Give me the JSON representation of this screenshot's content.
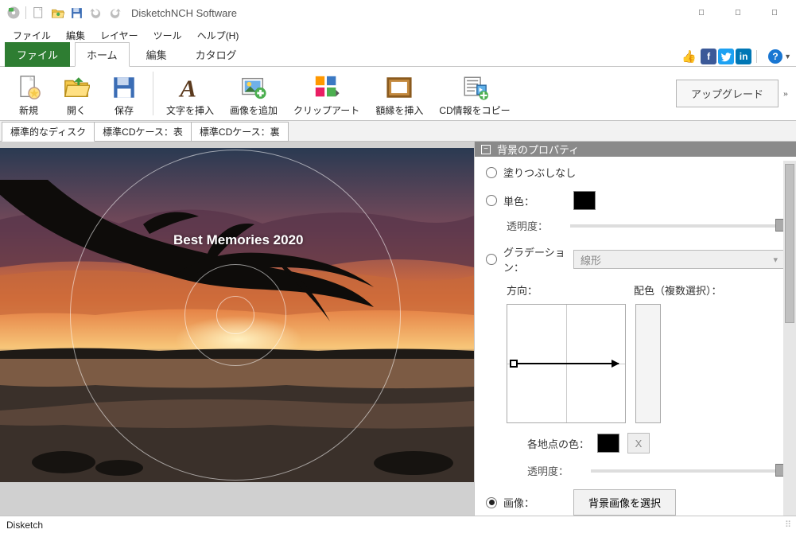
{
  "window": {
    "title": "DisketchNCH Software"
  },
  "menubar": {
    "file": "ファイル",
    "edit": "編集",
    "layer": "レイヤー",
    "tool": "ツール",
    "help": "ヘルプ(H)"
  },
  "ribbon_tabs": {
    "file": "ファイル",
    "home": "ホーム",
    "edit": "編集",
    "catalog": "カタログ"
  },
  "ribbon_buttons": {
    "new": "新規",
    "open": "開く",
    "save": "保存",
    "insert_text": "文字を挿入",
    "add_image": "画像を追加",
    "clipart": "クリップアート",
    "insert_frame": "額縁を挿入",
    "copy_cdinfo": "CD情報をコピー"
  },
  "upgrade": {
    "label": "アップグレード"
  },
  "doc_tabs": {
    "standard_disc": "標準的なディスク",
    "cd_case_front": "標準CDケース：表",
    "cd_case_back": "標準CDケース：裏"
  },
  "canvas": {
    "disc_title": "Best Memories 2020"
  },
  "prop": {
    "header": "背景のプロパティ",
    "fill_none": "塗りつぶしなし",
    "fill_solid": "単色：",
    "opacity": "透明度：",
    "fill_gradient": "グラデーション：",
    "grad_type": "線形",
    "direction": "方向：",
    "colors_multi": "配色（複数選択）：",
    "stop_color": "各地点の色：",
    "fill_image": "画像：",
    "select_bg_image": "背景画像を選択"
  },
  "status": {
    "text": "Disketch"
  }
}
